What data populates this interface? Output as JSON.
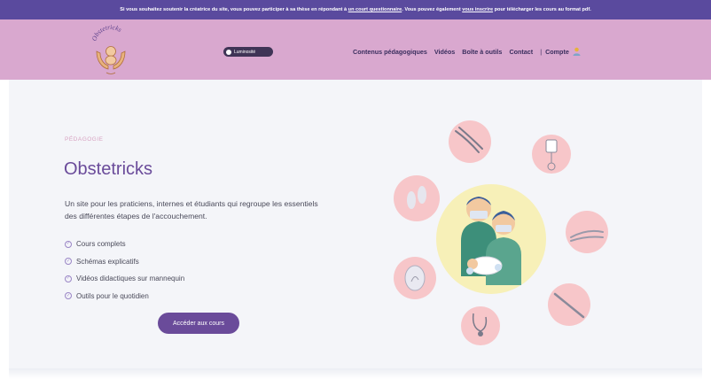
{
  "topbar": {
    "text1": "Si vous souhaitez soutenir la créatrice du site, vous pouvez participer à sa thèse en répondant à",
    "link1": "un court questionnaire",
    "text2": ". Vous pouvez également",
    "link2": "vous inscrire",
    "text3": "pour télécharger les cours au format pdf."
  },
  "header": {
    "logo_text": "Obstetricks",
    "toggle_label": "Luminosité",
    "nav": [
      {
        "label": "Contenus pédagogiques"
      },
      {
        "label": "Vidéos"
      },
      {
        "label": "Boîte à outils"
      },
      {
        "label": "Contact"
      }
    ],
    "separator": "|",
    "account_label": "Compte",
    "account_icon": "user-icon"
  },
  "hero": {
    "kicker": "PÉDAGOGIE",
    "title": "Obstetricks",
    "description": "Un site pour les praticiens, internes et étudiants qui regroupe les essentiels des différentes étapes de l'accouchement.",
    "features": [
      "Cours complets",
      "Schémas explicatifs",
      "Vidéos didactiques sur mannequin",
      "Outils pour le quotidien"
    ],
    "check_icon": "check-circle-icon",
    "cta_label": "Accéder aux cours"
  },
  "colors": {
    "topbar_bg": "#5a4a9e",
    "header_bg": "#d9a8cf",
    "accent": "#6a4b9a",
    "kicker": "#d8a4c2",
    "circle_pink": "#f7c6c9",
    "circle_yellow": "#f7f0b8"
  },
  "illustration": {
    "center": "medical-team-illustration",
    "circles": [
      "forceps-icon",
      "infusion-bottle-icon",
      "footprints-icon",
      "speculum-icon",
      "ultrasound-icon",
      "scalpel-icon",
      "stethoscope-icon"
    ]
  }
}
